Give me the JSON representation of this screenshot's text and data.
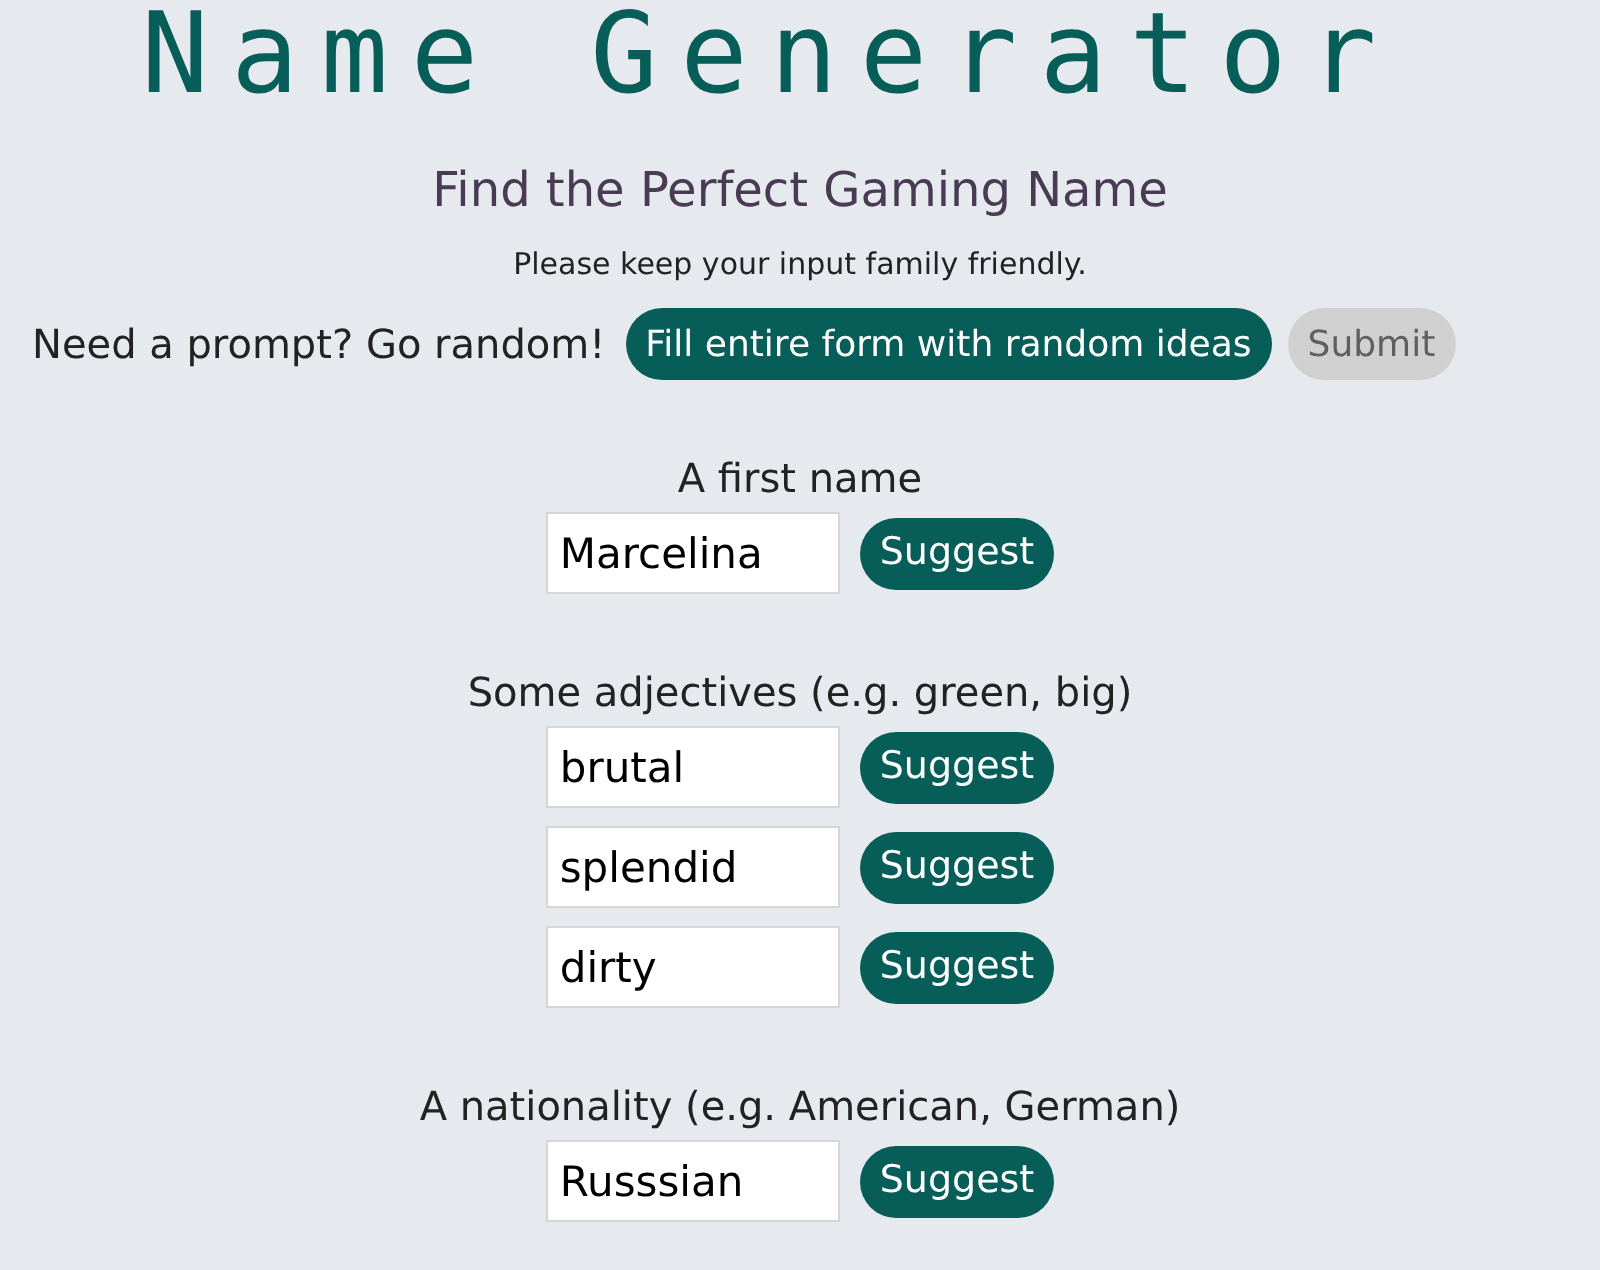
{
  "title": "Name Generator",
  "subtitle": "Find the Perfect Gaming Name",
  "notice": "Please keep your input family friendly.",
  "random_prompt": {
    "text": "Need a prompt? Go random!",
    "fill_button": "Fill entire form with random ideas",
    "submit_button": {
      "label": "Submit",
      "disabled": true
    }
  },
  "sections": [
    {
      "label": "A first name",
      "fields": [
        {
          "value": "Marcelina",
          "button": "Suggest"
        }
      ]
    },
    {
      "label": "Some adjectives (e.g. green, big)",
      "fields": [
        {
          "value": "brutal",
          "button": "Suggest"
        },
        {
          "value": "splendid",
          "button": "Suggest"
        },
        {
          "value": "dirty",
          "button": "Suggest"
        }
      ]
    },
    {
      "label": "A nationality (e.g. American, German)",
      "fields": [
        {
          "value": "Russsian",
          "button": "Suggest"
        }
      ]
    }
  ]
}
